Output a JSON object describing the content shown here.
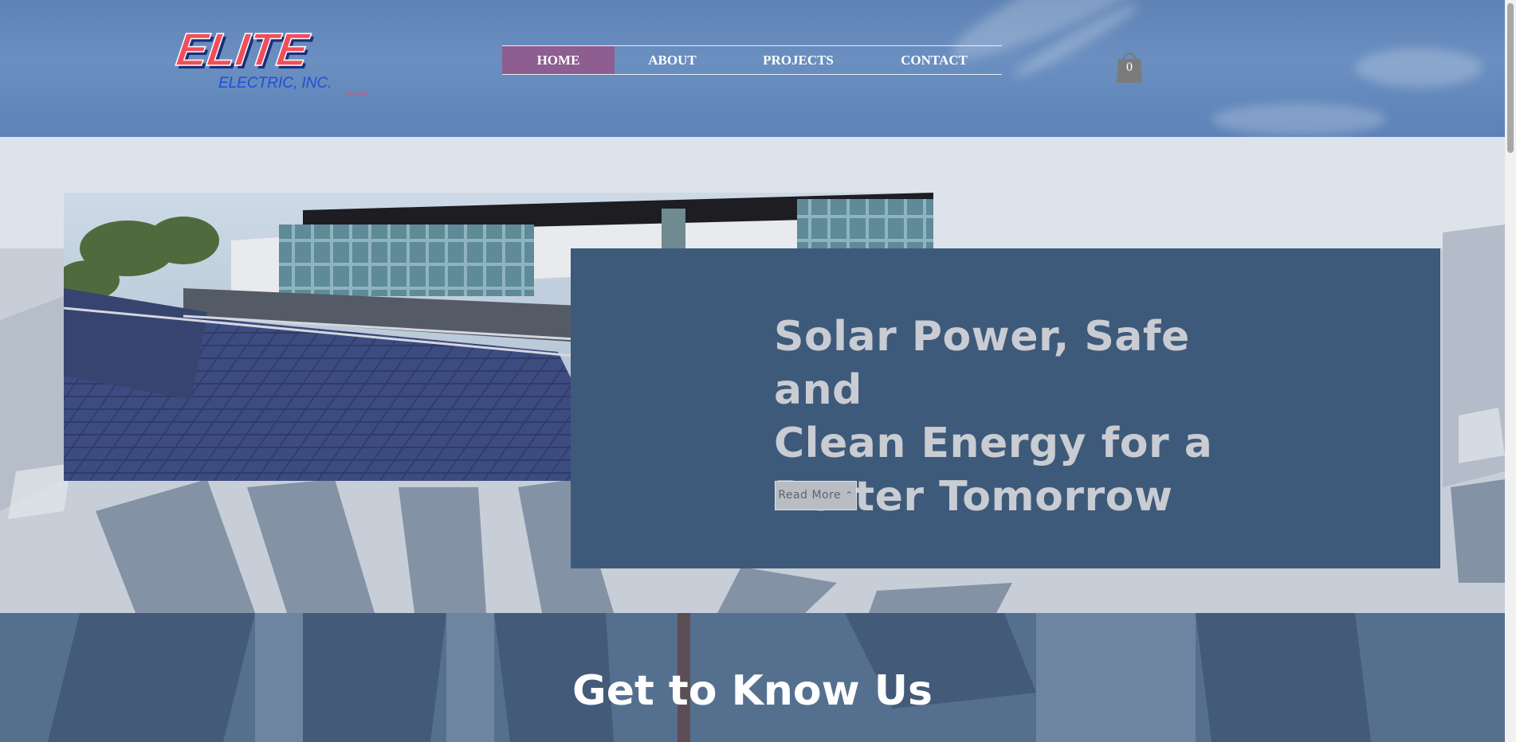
{
  "header": {
    "logo": {
      "name": "ELITE",
      "tagline": "ELECTRIC, INC.",
      "since": "SINCE 1979"
    },
    "nav": [
      {
        "label": "HOME",
        "active": true
      },
      {
        "label": "ABOUT",
        "active": false
      },
      {
        "label": "PROJECTS",
        "active": false
      },
      {
        "label": "CONTACT",
        "active": false
      }
    ],
    "cart": {
      "count": "0",
      "icon": "shopping-bag-icon"
    }
  },
  "hero": {
    "title": "Solar Power, Safe and Clean Energy for a Better Tomorrow",
    "title_lines": [
      "Solar Power, Safe and",
      "Clean Energy for a",
      "Better Tomorrow"
    ],
    "read_more_label": "Read More",
    "read_more_icon": "chevron-up-icon"
  },
  "about": {
    "title": "Get to Know Us"
  },
  "colors": {
    "nav_active": "#8d5e8f",
    "hero_box": "#3e5a7a",
    "logo_red": "#f04e5c",
    "logo_blue": "#1f4fd6"
  }
}
